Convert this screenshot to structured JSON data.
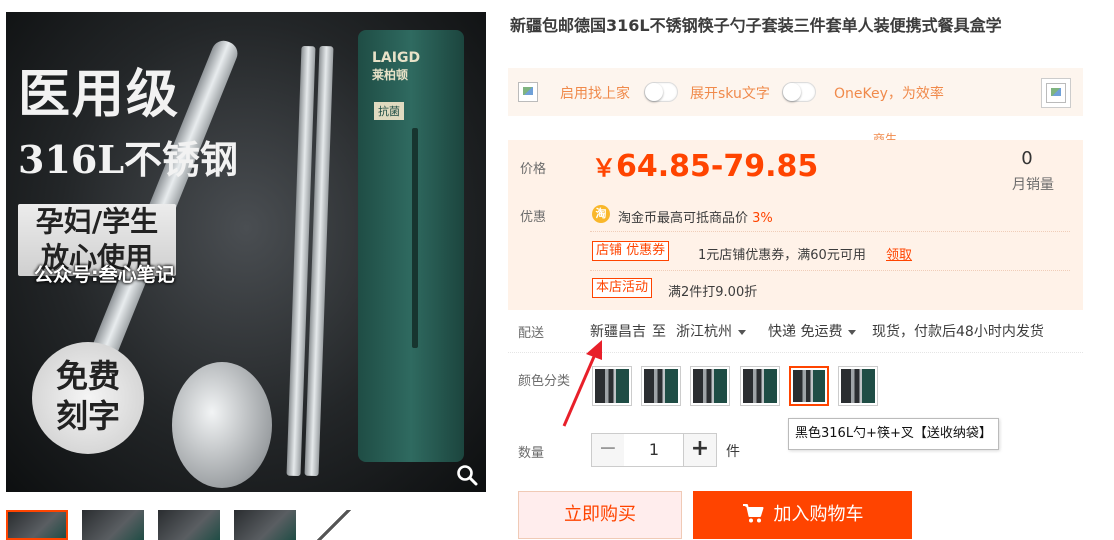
{
  "gallery": {
    "headline_1": "医用级",
    "headline_2": "316L不锈钢",
    "tag_line_1": "孕妇/学生",
    "tag_line_2": "放心使用",
    "watermark": "公众号:叁心笔记",
    "badge_line_1": "免费",
    "badge_line_2": "刻字",
    "brand": "LAIGD",
    "brand_cn": "莱柏顿",
    "antibacterial": "抗菌"
  },
  "product": {
    "title": "新疆包邮德国316L不锈钢筷子勺子套装三件套单人装便携式餐具盒学"
  },
  "plugin": {
    "find_source": "启用找上家",
    "expand_sku": "展开sku文字",
    "onekey": "OneKey，为效率",
    "faint": "商生"
  },
  "price": {
    "label": "价格",
    "currency": "￥",
    "value": "64.85-79.85",
    "sales_count": "0",
    "sales_label": "月销量"
  },
  "promotions": {
    "label": "优惠",
    "coin_icon": "淘",
    "coin_text": "淘金币最高可抵商品价",
    "coin_pct": "3%",
    "coupon_tag": "店铺 优惠券",
    "coupon_text": "1元店铺优惠券，满60元可用",
    "coupon_link": "领取",
    "activity_tag": "本店活动",
    "activity_text": "满2件打9.00折"
  },
  "shipping": {
    "label": "配送",
    "from": "新疆昌吉",
    "to_word": "至",
    "dest": "浙江杭州",
    "method": "快递 免运费",
    "note": "现货，付款后48小时内发货"
  },
  "color": {
    "label": "颜色分类",
    "tooltip": "黑色316L勺+筷+叉【送收纳袋】"
  },
  "quantity": {
    "label": "数量",
    "minus": "−",
    "value": "1",
    "plus": "+",
    "unit": "件"
  },
  "actions": {
    "buy_now": "立即购买",
    "add_cart": "加入购物车"
  },
  "colors": {
    "accent": "#ff4400",
    "price_bg": "#fff2e8",
    "plugin_text": "#f08a4b",
    "case_green": "#1f4d45"
  }
}
